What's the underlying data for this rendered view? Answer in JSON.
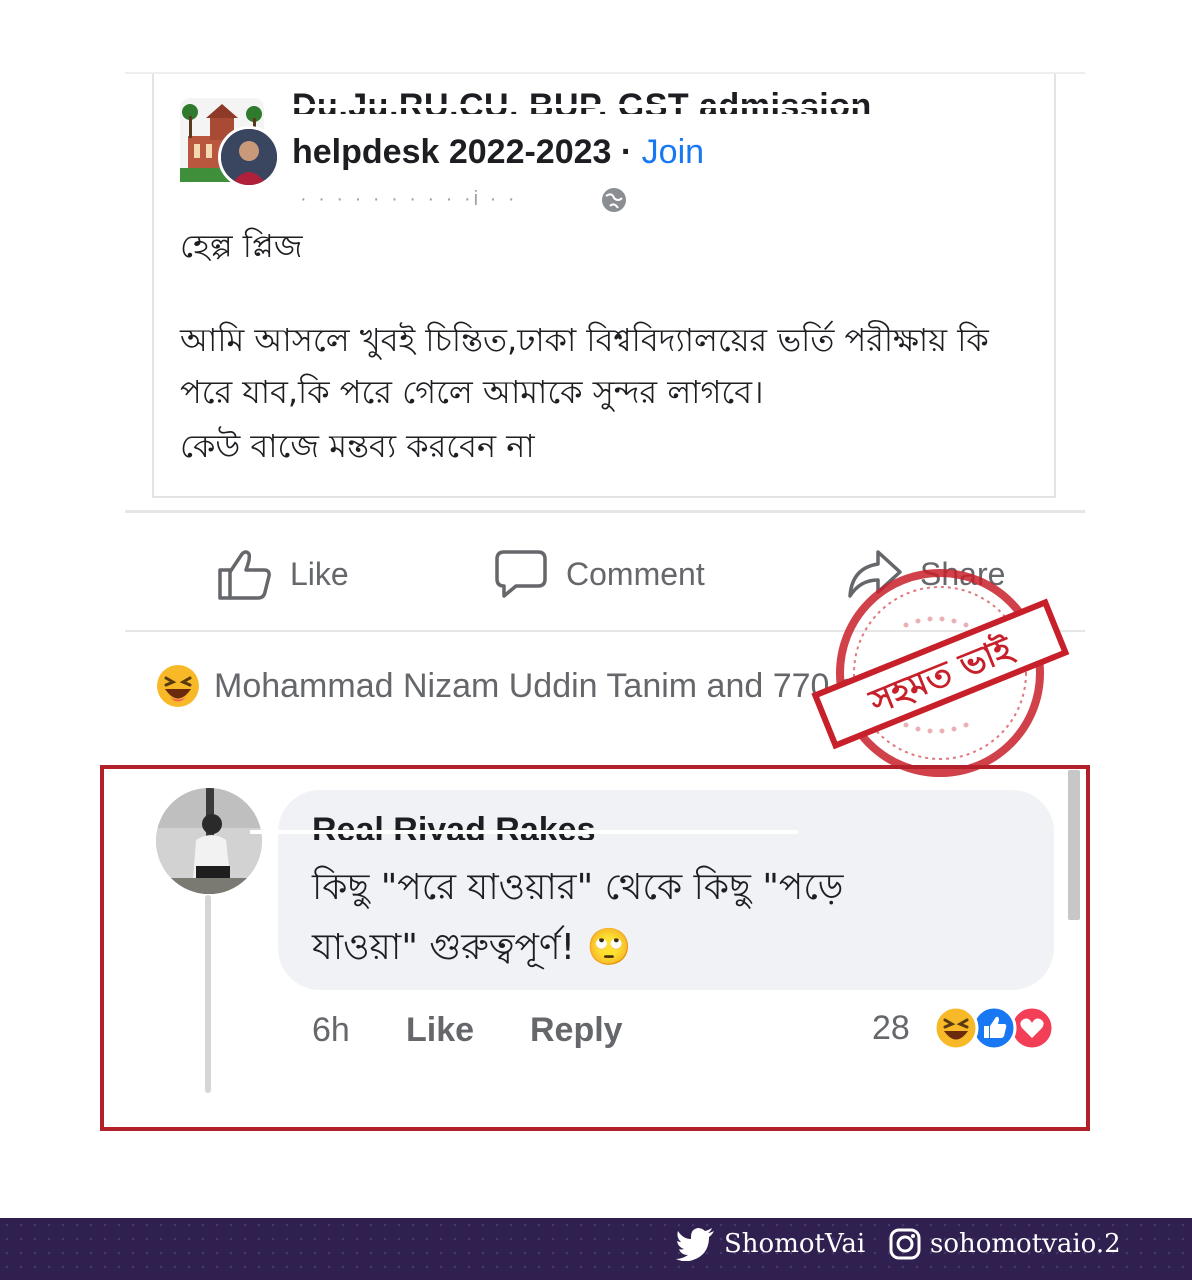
{
  "post": {
    "group_name_line1": "Du,Ju,RU,CU, BUP, GST admission",
    "group_name_line2": "helpdesk 2022-2023",
    "separator": " · ",
    "join_label": "Join",
    "meta_blurred": "·  ·   · · · · ·    · · ·i · ·",
    "body_lines": [
      "হেল্প প্লিজ",
      "আমি আসলে খুবই চিন্তিত,ঢাকা বিশ্ববিদ্যালয়ের ভর্তি পরীক্ষায় কি",
      "পরে যাব,কি পরে গেলে আমাকে সুন্দর লাগবে।",
      "কেউ বাজে মন্তব্য করবেন না"
    ]
  },
  "actions": {
    "like_label": "Like",
    "comment_label": "Comment",
    "share_label": "Share"
  },
  "reactions_summary": "Mohammad Nizam Uddin Tanim and 770 others",
  "stamp": {
    "text": "সহমত ভাই",
    "color": "#c8202a"
  },
  "comment": {
    "author": "Real Riyad Rakes",
    "lines": [
      "কিছু \"পরে যাওয়ার\" থেকে কিছু \"পড়ে",
      "যাওয়া\" গুরুত্বপূর্ণ! 🙄"
    ],
    "time": "6h",
    "like_label": "Like",
    "reply_label": "Reply",
    "reaction_count": "28"
  },
  "footer": {
    "twitter_handle": "ShomotVai",
    "instagram_handle": "sohomotvaio.2"
  },
  "colors": {
    "facebook_blue": "#1877f2",
    "highlight_red": "#b3202a",
    "footer_bg": "#2f2050",
    "muted_text": "#65676b"
  }
}
